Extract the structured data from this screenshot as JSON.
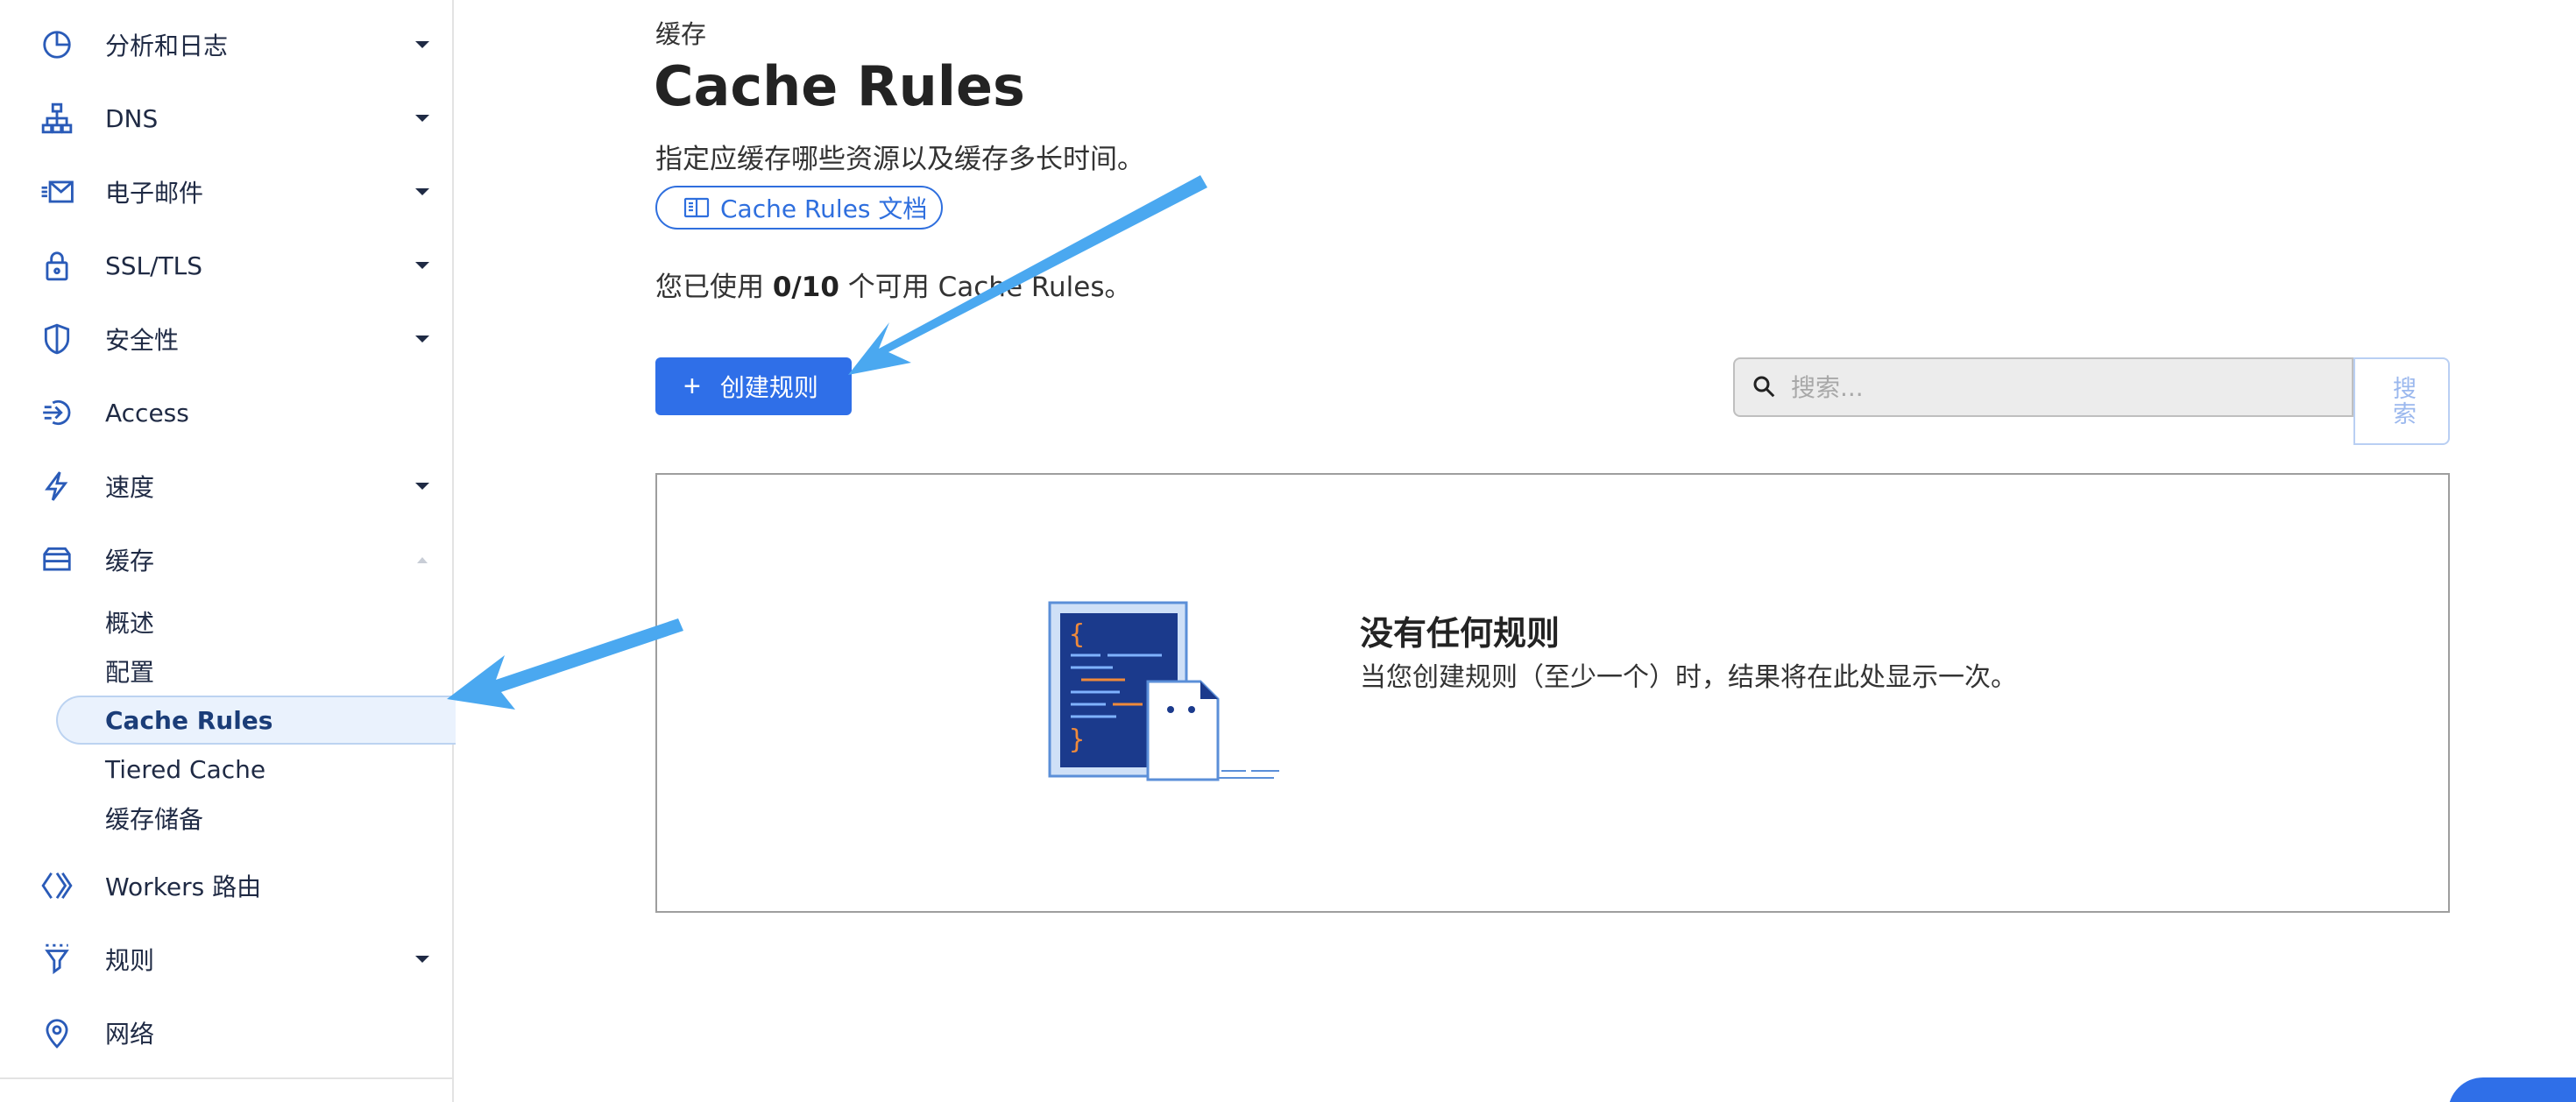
{
  "sidebar": {
    "items": [
      {
        "label": "分析和日志",
        "icon": "pie-chart-icon",
        "expanded": false
      },
      {
        "label": "DNS",
        "icon": "network-tree-icon",
        "expanded": false
      },
      {
        "label": "电子邮件",
        "icon": "mail-icon",
        "expanded": false
      },
      {
        "label": "SSL/TLS",
        "icon": "lock-icon",
        "expanded": false
      },
      {
        "label": "安全性",
        "icon": "shield-icon",
        "expanded": false
      },
      {
        "label": "Access",
        "icon": "access-icon"
      },
      {
        "label": "速度",
        "icon": "lightning-icon",
        "expanded": false
      },
      {
        "label": "缓存",
        "icon": "storage-icon",
        "expanded": true
      },
      {
        "label": "Workers 路由",
        "icon": "workers-icon"
      },
      {
        "label": "规则",
        "icon": "funnel-icon",
        "expanded": false
      },
      {
        "label": "网络",
        "icon": "location-pin-icon"
      }
    ],
    "cache_sub": [
      {
        "label": "概述"
      },
      {
        "label": "配置"
      },
      {
        "label": "Cache Rules",
        "active": true
      },
      {
        "label": "Tiered Cache"
      },
      {
        "label": "缓存储备"
      }
    ]
  },
  "main": {
    "breadcrumb": "缓存",
    "title": "Cache Rules",
    "description": "指定应缓存哪些资源以及缓存多长时间。",
    "doc_link": "Cache Rules 文档",
    "usage_prefix": "您已使用 ",
    "usage_count": "0/10",
    "usage_suffix": " 个可用 Cache Rules。",
    "create_button": "创建规则",
    "search_placeholder": "搜索...",
    "search_button": "搜索",
    "empty_title": "没有任何规则",
    "empty_description": "当您创建规则（至少一个）时，结果将在此处显示一次。"
  },
  "colors": {
    "accent": "#2f6fe8",
    "annotation_arrow": "#4aa8f0",
    "active_bg": "#eaf2fd"
  }
}
